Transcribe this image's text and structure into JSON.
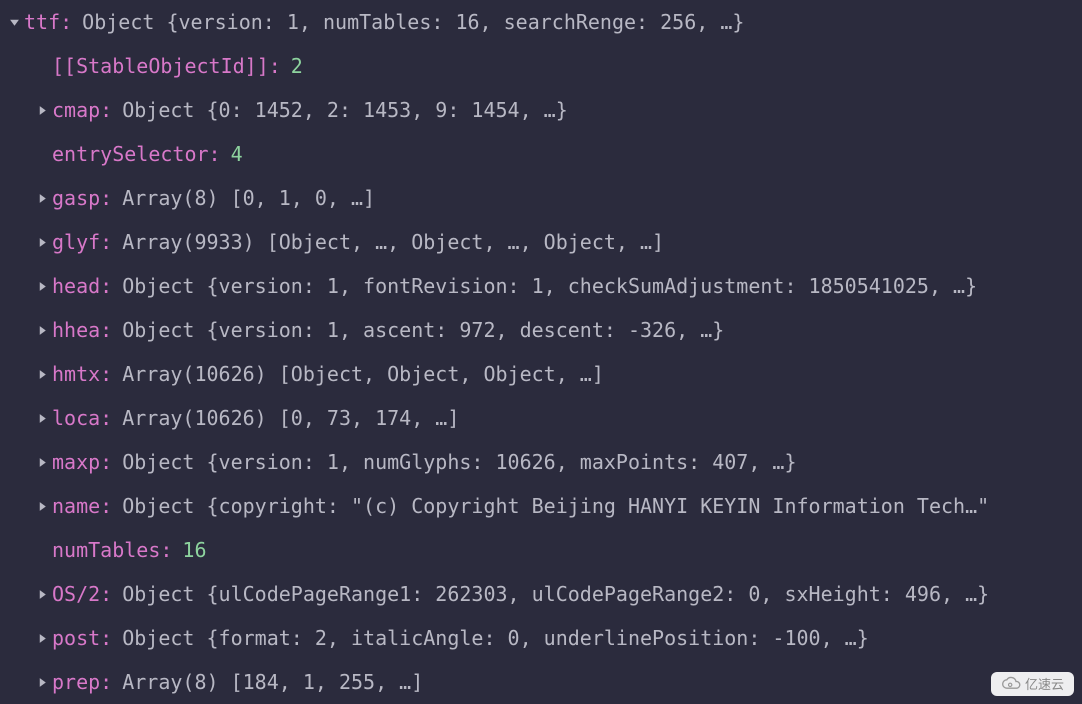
{
  "root": {
    "key": "ttf",
    "value": "Object {version: 1, numTables: 16, searchRenge: 256, …}"
  },
  "rows": [
    {
      "expandable": false,
      "key": "[[StableObjectId]]",
      "bracket": true,
      "numValue": "2"
    },
    {
      "expandable": true,
      "key": "cmap",
      "value": "Object {0: 1452, 2: 1453, 9: 1454, …}"
    },
    {
      "expandable": false,
      "key": "entrySelector",
      "numValue": "4"
    },
    {
      "expandable": true,
      "key": "gasp",
      "value": "Array(8) [0, 1, 0, …]"
    },
    {
      "expandable": true,
      "key": "glyf",
      "value": "Array(9933) [Object, …, Object, …, Object, …]"
    },
    {
      "expandable": true,
      "key": "head",
      "value": "Object {version: 1, fontRevision: 1, checkSumAdjustment: 1850541025, …}"
    },
    {
      "expandable": true,
      "key": "hhea",
      "value": "Object {version: 1, ascent: 972, descent: -326, …}"
    },
    {
      "expandable": true,
      "key": "hmtx",
      "value": "Array(10626) [Object, Object, Object, …]"
    },
    {
      "expandable": true,
      "key": "loca",
      "value": "Array(10626) [0, 73, 174, …]"
    },
    {
      "expandable": true,
      "key": "maxp",
      "value": "Object {version: 1, numGlyphs: 10626, maxPoints: 407, …}"
    },
    {
      "expandable": true,
      "key": "name",
      "value": "Object {copyright: \"(c) Copyright Beijing HANYI KEYIN Information Tech…\""
    },
    {
      "expandable": false,
      "key": "numTables",
      "numValue": "16"
    },
    {
      "expandable": true,
      "key": "OS/2",
      "value": "Object {ulCodePageRange1: 262303, ulCodePageRange2: 0, sxHeight: 496, …}"
    },
    {
      "expandable": true,
      "key": "post",
      "value": "Object {format: 2, italicAngle: 0, underlinePosition: -100, …}"
    },
    {
      "expandable": true,
      "key": "prep",
      "value": "Array(8) [184, 1, 255, …]"
    }
  ],
  "watermark": {
    "text": "亿速云"
  }
}
